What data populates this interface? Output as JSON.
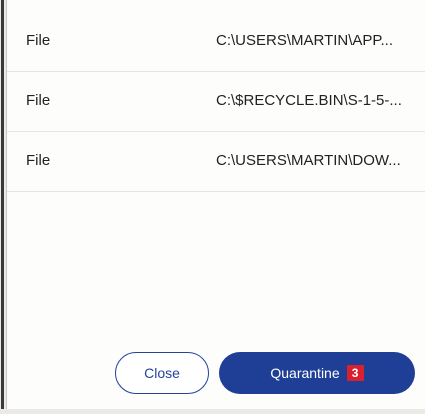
{
  "files": [
    {
      "type": "File",
      "path": "C:\\USERS\\MARTIN\\APP..."
    },
    {
      "type": "File",
      "path": "C:\\$RECYCLE.BIN\\S-1-5-..."
    },
    {
      "type": "File",
      "path": "C:\\USERS\\MARTIN\\DOW..."
    }
  ],
  "footer": {
    "close_label": "Close",
    "quarantine_label": "Quarantine",
    "quarantine_count": "3"
  },
  "colors": {
    "primary": "#1f3e96",
    "badge": "#d8202f"
  }
}
